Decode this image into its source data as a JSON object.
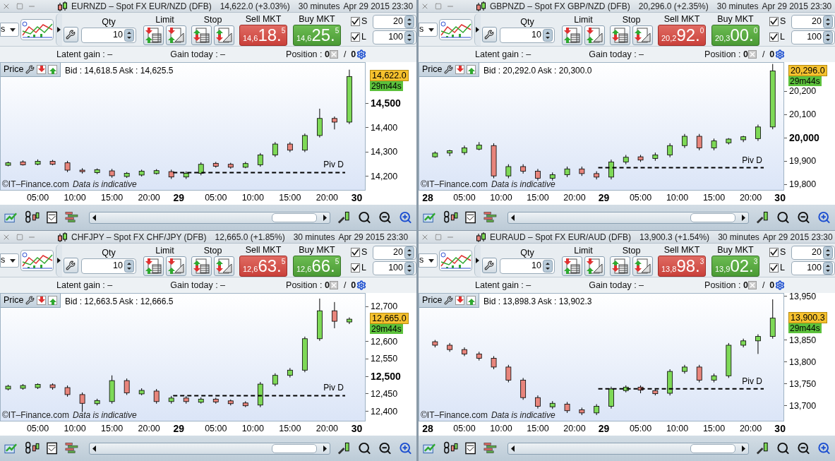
{
  "panels": [
    {
      "title": "EURNZD – Spot FX EUR/NZD (DFB)",
      "quote": "14,622.0 (+3.03%)",
      "interval": "30 minutes",
      "datetime": "Apr 29 2015 23:30",
      "dropdown": "s",
      "qty_label": "Qty",
      "qty": "10",
      "limit_label": "Limit",
      "stop_label": "Stop",
      "sell": {
        "label": "Sell MKT",
        "prefix": "14,6",
        "big": "18.",
        "sup": "5"
      },
      "buy": {
        "label": "Buy MKT",
        "prefix": "14,6",
        "big": "25.",
        "sup": "5"
      },
      "checks": [
        {
          "label": "S",
          "checked": true,
          "value": "20"
        },
        {
          "label": "L",
          "checked": true,
          "value": "100"
        }
      ],
      "latent_gain": "Latent gain : –",
      "gain_today": "Gain today : –",
      "position": "Position : **0**",
      "position_total": "/  **0**",
      "price_button": "Price",
      "bid_ask": "Bid : 14,618.5 Ask : 14,625.5",
      "last_price": "14,622.0",
      "countdown": "29m44s",
      "copyright": "©IT–Finance.com",
      "disclaimer": "Data is indicative",
      "chart_data": {
        "type": "candlestick",
        "x": [
          "2015-04-28T01:00:00Z",
          "2015-04-28T03:00:00Z",
          "2015-04-28T05:00:00Z",
          "2015-04-28T07:00:00Z",
          "2015-04-28T09:00:00Z",
          "2015-04-28T11:00:00Z",
          "2015-04-28T13:00:00Z",
          "2015-04-28T15:00:00Z",
          "2015-04-28T17:00:00Z",
          "2015-04-28T19:00:00Z",
          "2015-04-28T21:00:00Z",
          "2015-04-28T23:00:00Z",
          "2015-04-29T01:00:00Z",
          "2015-04-29T03:00:00Z",
          "2015-04-29T05:00:00Z",
          "2015-04-29T07:00:00Z",
          "2015-04-29T09:00:00Z",
          "2015-04-29T11:00:00Z",
          "2015-04-29T13:00:00Z",
          "2015-04-29T15:00:00Z",
          "2015-04-29T17:00:00Z",
          "2015-04-29T19:00:00Z",
          "2015-04-29T21:00:00Z",
          "2015-04-29T23:00:00Z"
        ],
        "ohlc": [
          [
            14248,
            14263,
            14244,
            14258
          ],
          [
            14262,
            14268,
            14247,
            14250
          ],
          [
            14252,
            14272,
            14248,
            14264
          ],
          [
            14264,
            14270,
            14248,
            14252
          ],
          [
            14258,
            14266,
            14220,
            14228
          ],
          [
            14228,
            14236,
            14214,
            14222
          ],
          [
            14218,
            14235,
            14212,
            14230
          ],
          [
            14225,
            14233,
            14197,
            14205
          ],
          [
            14202,
            14220,
            14196,
            14215
          ],
          [
            14208,
            14230,
            14202,
            14224
          ],
          [
            14214,
            14232,
            14210,
            14226
          ],
          [
            14222,
            14230,
            14192,
            14200
          ],
          [
            14200,
            14223,
            14192,
            14215
          ],
          [
            14215,
            14260,
            14207,
            14252
          ],
          [
            14256,
            14262,
            14238,
            14244
          ],
          [
            14252,
            14258,
            14234,
            14240
          ],
          [
            14240,
            14262,
            14236,
            14255
          ],
          [
            14250,
            14298,
            14242,
            14290
          ],
          [
            14290,
            14343,
            14282,
            14335
          ],
          [
            14335,
            14343,
            14302,
            14310
          ],
          [
            14310,
            14378,
            14302,
            14370
          ],
          [
            14370,
            14480,
            14362,
            14440
          ],
          [
            14440,
            14448,
            14395,
            14425
          ],
          [
            14425,
            14640,
            14417,
            14612
          ]
        ],
        "xlim": [
          "2015-04-28T00:00:00Z",
          "2015-04-30T01:06:00Z"
        ],
        "ylim": [
          14147,
          14668
        ],
        "xticks": [
          {
            "value": "2015-04-28T05:00:00Z",
            "label": "05:00"
          },
          {
            "value": "2015-04-28T10:00:00Z",
            "label": "10:00"
          },
          {
            "value": "2015-04-28T15:00:00Z",
            "label": "15:00"
          },
          {
            "value": "2015-04-28T20:00:00Z",
            "label": "20:00"
          },
          {
            "value": "2015-04-29T00:00:00Z",
            "label": "29"
          },
          {
            "value": "2015-04-29T05:00:00Z",
            "label": "05:00"
          },
          {
            "value": "2015-04-29T10:00:00Z",
            "label": "10:00"
          },
          {
            "value": "2015-04-29T15:00:00Z",
            "label": "15:00"
          },
          {
            "value": "2015-04-29T20:00:00Z",
            "label": "20:00"
          },
          {
            "value": "2015-04-30T00:00:00Z",
            "label": "30"
          }
        ],
        "yticks": [
          {
            "value": 14200,
            "label": "14,200"
          },
          {
            "value": 14300,
            "label": "14,300"
          },
          {
            "value": 14400,
            "label": "14,400"
          },
          {
            "value": 14500,
            "label": "14,500"
          }
        ],
        "ref_lines": [
          {
            "axis": "y",
            "value": 14218,
            "label": "Piv D"
          }
        ]
      }
    },
    {
      "title": "GBPNZD – Spot FX GBP/NZD (DFB)",
      "quote": "20,296.0 (+2.35%)",
      "interval": "30 minutes",
      "datetime": "Apr 29 2015 23:30",
      "dropdown": "s",
      "qty_label": "Qty",
      "qty": "10",
      "limit_label": "Limit",
      "stop_label": "Stop",
      "sell": {
        "label": "Sell MKT",
        "prefix": "20,2",
        "big": "92.",
        "sup": "0"
      },
      "buy": {
        "label": "Buy MKT",
        "prefix": "20,3",
        "big": "00.",
        "sup": "0"
      },
      "checks": [
        {
          "label": "S",
          "checked": true,
          "value": "20"
        },
        {
          "label": "L",
          "checked": true,
          "value": "100"
        }
      ],
      "latent_gain": "Latent gain : –",
      "gain_today": "Gain today : –",
      "position": "Position : **0**",
      "position_total": "/  **0**",
      "price_button": "Price",
      "bid_ask": "Bid : 20,292.0 Ask : 20,300.0",
      "last_price": "20,296.0",
      "countdown": "29m44s",
      "copyright": "©IT–Finance.com",
      "disclaimer": "Data is indicative",
      "chart_data": {
        "type": "candlestick",
        "x": [
          "2015-04-28T01:00:00Z",
          "2015-04-28T03:00:00Z",
          "2015-04-28T05:00:00Z",
          "2015-04-28T07:00:00Z",
          "2015-04-28T09:00:00Z",
          "2015-04-28T11:00:00Z",
          "2015-04-28T13:00:00Z",
          "2015-04-28T15:00:00Z",
          "2015-04-28T17:00:00Z",
          "2015-04-28T19:00:00Z",
          "2015-04-28T21:00:00Z",
          "2015-04-28T23:00:00Z",
          "2015-04-29T01:00:00Z",
          "2015-04-29T03:00:00Z",
          "2015-04-29T05:00:00Z",
          "2015-04-29T07:00:00Z",
          "2015-04-29T09:00:00Z",
          "2015-04-29T11:00:00Z",
          "2015-04-29T13:00:00Z",
          "2015-04-29T15:00:00Z",
          "2015-04-29T17:00:00Z",
          "2015-04-29T19:00:00Z",
          "2015-04-29T21:00:00Z",
          "2015-04-29T23:00:00Z"
        ],
        "ohlc": [
          [
            19922,
            19945,
            19918,
            19938
          ],
          [
            19938,
            19952,
            19925,
            19948
          ],
          [
            19940,
            19970,
            19930,
            19960
          ],
          [
            19955,
            19985,
            19950,
            19972
          ],
          [
            19970,
            19980,
            19830,
            19840
          ],
          [
            19840,
            19890,
            19830,
            19880
          ],
          [
            19880,
            19890,
            19850,
            19860
          ],
          [
            19860,
            19870,
            19820,
            19830
          ],
          [
            19830,
            19855,
            19820,
            19845
          ],
          [
            19845,
            19880,
            19835,
            19870
          ],
          [
            19870,
            19880,
            19840,
            19850
          ],
          [
            19850,
            19860,
            19825,
            19835
          ],
          [
            19835,
            19910,
            19825,
            19900
          ],
          [
            19900,
            19930,
            19890,
            19920
          ],
          [
            19922,
            19930,
            19900,
            19908
          ],
          [
            19915,
            19940,
            19905,
            19930
          ],
          [
            19930,
            19980,
            19920,
            19970
          ],
          [
            19970,
            20020,
            19960,
            20010
          ],
          [
            20010,
            20020,
            19950,
            19960
          ],
          [
            19960,
            20000,
            19950,
            19990
          ],
          [
            19982,
            20002,
            19975,
            19998
          ],
          [
            19995,
            20012,
            19985,
            20008
          ],
          [
            20000,
            20060,
            19990,
            20050
          ],
          [
            20050,
            20320,
            20040,
            20290
          ]
        ],
        "xlim": [
          "2015-04-27T22:51:00Z",
          "2015-04-30T00:28:00Z"
        ],
        "ylim": [
          19780,
          20325
        ],
        "xticks": [
          {
            "value": "2015-04-28T00:00:00Z",
            "label": "28"
          },
          {
            "value": "2015-04-28T05:00:00Z",
            "label": "05:00"
          },
          {
            "value": "2015-04-28T10:00:00Z",
            "label": "10:00"
          },
          {
            "value": "2015-04-28T15:00:00Z",
            "label": "15:00"
          },
          {
            "value": "2015-04-28T20:00:00Z",
            "label": "20:00"
          },
          {
            "value": "2015-04-29T00:00:00Z",
            "label": "29"
          },
          {
            "value": "2015-04-29T05:00:00Z",
            "label": "05:00"
          },
          {
            "value": "2015-04-29T10:00:00Z",
            "label": "10:00"
          },
          {
            "value": "2015-04-29T15:00:00Z",
            "label": "15:00"
          },
          {
            "value": "2015-04-29T20:00:00Z",
            "label": "20:00"
          },
          {
            "value": "2015-04-30T00:00:00Z",
            "label": "30"
          }
        ],
        "yticks": [
          {
            "value": 19800,
            "label": "19,800"
          },
          {
            "value": 19900,
            "label": "19,900"
          },
          {
            "value": 20000,
            "label": "20,000"
          },
          {
            "value": 20100,
            "label": "20,100"
          },
          {
            "value": 20200,
            "label": "20,200"
          }
        ],
        "ref_lines": [
          {
            "axis": "y",
            "value": 19875,
            "label": "Piv D"
          }
        ]
      }
    },
    {
      "title": "CHFJPY – Spot FX CHF/JPY (DFB)",
      "quote": "12,665.0 (+1.85%)",
      "interval": "30 minutes",
      "datetime": "Apr 29 2015 23:30",
      "dropdown": "s",
      "qty_label": "Qty",
      "qty": "10",
      "limit_label": "Limit",
      "stop_label": "Stop",
      "sell": {
        "label": "Sell MKT",
        "prefix": "12,6",
        "big": "63.",
        "sup": "5"
      },
      "buy": {
        "label": "Buy MKT",
        "prefix": "12,6",
        "big": "66.",
        "sup": "5"
      },
      "checks": [
        {
          "label": "S",
          "checked": true,
          "value": "20"
        },
        {
          "label": "L",
          "checked": true,
          "value": "100"
        }
      ],
      "latent_gain": "Latent gain : –",
      "gain_today": "Gain today : –",
      "position": "Position : **0**",
      "position_total": "/  **0**",
      "price_button": "Price",
      "bid_ask": "Bid : 12,663.5 Ask : 12,666.5",
      "last_price": "12,665.0",
      "countdown": "29m44s",
      "copyright": "©IT–Finance.com",
      "disclaimer": "Data is indicative",
      "chart_data": {
        "type": "candlestick",
        "x": [
          "2015-04-28T01:00:00Z",
          "2015-04-28T03:00:00Z",
          "2015-04-28T05:00:00Z",
          "2015-04-28T07:00:00Z",
          "2015-04-28T09:00:00Z",
          "2015-04-28T11:00:00Z",
          "2015-04-28T13:00:00Z",
          "2015-04-28T15:00:00Z",
          "2015-04-28T17:00:00Z",
          "2015-04-28T19:00:00Z",
          "2015-04-28T21:00:00Z",
          "2015-04-28T23:00:00Z",
          "2015-04-29T01:00:00Z",
          "2015-04-29T03:00:00Z",
          "2015-04-29T05:00:00Z",
          "2015-04-29T07:00:00Z",
          "2015-04-29T09:00:00Z",
          "2015-04-29T11:00:00Z",
          "2015-04-29T13:00:00Z",
          "2015-04-29T15:00:00Z",
          "2015-04-29T17:00:00Z",
          "2015-04-29T19:00:00Z",
          "2015-04-29T21:00:00Z",
          "2015-04-29T23:00:00Z"
        ],
        "ohlc": [
          [
            12466,
            12478,
            12462,
            12474
          ],
          [
            12468,
            12480,
            12464,
            12476
          ],
          [
            12470,
            12482,
            12466,
            12479
          ],
          [
            12478,
            12482,
            12464,
            12470
          ],
          [
            12470,
            12476,
            12444,
            12450
          ],
          [
            12450,
            12456,
            12400,
            12425
          ],
          [
            12424,
            12438,
            12419,
            12433
          ],
          [
            12430,
            12505,
            12424,
            12490
          ],
          [
            12490,
            12496,
            12449,
            12455
          ],
          [
            12452,
            12468,
            12448,
            12462
          ],
          [
            12460,
            12466,
            12424,
            12430
          ],
          [
            12430,
            12446,
            12424,
            12440
          ],
          [
            12440,
            12446,
            12424,
            12430
          ],
          [
            12428,
            12442,
            12424,
            12437
          ],
          [
            12437,
            12441,
            12424,
            12429
          ],
          [
            12432,
            12436,
            12419,
            12424
          ],
          [
            12426,
            12431,
            12414,
            12418
          ],
          [
            12420,
            12486,
            12414,
            12480
          ],
          [
            12480,
            12511,
            12474,
            12505
          ],
          [
            12505,
            12526,
            12499,
            12520
          ],
          [
            12520,
            12616,
            12514,
            12610
          ],
          [
            12610,
            12725,
            12604,
            12690
          ],
          [
            12690,
            12715,
            12640,
            12660
          ],
          [
            12658,
            12671,
            12652,
            12666
          ]
        ],
        "xlim": [
          "2015-04-28T00:00:00Z",
          "2015-04-30T01:06:00Z"
        ],
        "ylim": [
          12375,
          12739
        ],
        "xticks": [
          {
            "value": "2015-04-28T05:00:00Z",
            "label": "05:00"
          },
          {
            "value": "2015-04-28T10:00:00Z",
            "label": "10:00"
          },
          {
            "value": "2015-04-28T15:00:00Z",
            "label": "15:00"
          },
          {
            "value": "2015-04-28T20:00:00Z",
            "label": "20:00"
          },
          {
            "value": "2015-04-29T00:00:00Z",
            "label": "29"
          },
          {
            "value": "2015-04-29T05:00:00Z",
            "label": "05:00"
          },
          {
            "value": "2015-04-29T10:00:00Z",
            "label": "10:00"
          },
          {
            "value": "2015-04-29T15:00:00Z",
            "label": "15:00"
          },
          {
            "value": "2015-04-29T20:00:00Z",
            "label": "20:00"
          },
          {
            "value": "2015-04-30T00:00:00Z",
            "label": "30"
          }
        ],
        "yticks": [
          {
            "value": 12400,
            "label": "12,400"
          },
          {
            "value": 12450,
            "label": "12,450"
          },
          {
            "value": 12500,
            "label": "12,500"
          },
          {
            "value": 12550,
            "label": "12,550"
          },
          {
            "value": 12600,
            "label": "12,600"
          },
          {
            "value": 12700,
            "label": "12,700"
          }
        ],
        "ref_lines": [
          {
            "axis": "y",
            "value": 12447,
            "label": "Piv D"
          }
        ]
      }
    },
    {
      "title": "EURAUD – Spot FX EUR/AUD (DFB)",
      "quote": "13,900.3 (+1.54%)",
      "interval": "30 minutes",
      "datetime": "Apr 29 2015 23:30",
      "dropdown": "s",
      "qty_label": "Qty",
      "qty": "10",
      "limit_label": "Limit",
      "stop_label": "Stop",
      "sell": {
        "label": "Sell MKT",
        "prefix": "13,8",
        "big": "98.",
        "sup": "3"
      },
      "buy": {
        "label": "Buy MKT",
        "prefix": "13,9",
        "big": "02.",
        "sup": "3"
      },
      "checks": [
        {
          "label": "S",
          "checked": true,
          "value": "20"
        },
        {
          "label": "L",
          "checked": true,
          "value": "100"
        }
      ],
      "latent_gain": "Latent gain : –",
      "gain_today": "Gain today : –",
      "position": "Position : **0**",
      "position_total": "/  **0**",
      "price_button": "Price",
      "bid_ask": "Bid : 13,898.3 Ask : 13,902.3",
      "last_price": "13,900.3",
      "countdown": "29m44s",
      "copyright": "©IT–Finance.com",
      "disclaimer": "Data is indicative",
      "chart_data": {
        "type": "candlestick",
        "x": [
          "2015-04-28T01:00:00Z",
          "2015-04-28T03:00:00Z",
          "2015-04-28T05:00:00Z",
          "2015-04-28T07:00:00Z",
          "2015-04-28T09:00:00Z",
          "2015-04-28T11:00:00Z",
          "2015-04-28T13:00:00Z",
          "2015-04-28T15:00:00Z",
          "2015-04-28T17:00:00Z",
          "2015-04-28T19:00:00Z",
          "2015-04-28T21:00:00Z",
          "2015-04-28T23:00:00Z",
          "2015-04-29T01:00:00Z",
          "2015-04-29T03:00:00Z",
          "2015-04-29T05:00:00Z",
          "2015-04-29T07:00:00Z",
          "2015-04-29T09:00:00Z",
          "2015-04-29T11:00:00Z",
          "2015-04-29T13:00:00Z",
          "2015-04-29T15:00:00Z",
          "2015-04-29T17:00:00Z",
          "2015-04-29T19:00:00Z",
          "2015-04-29T21:00:00Z",
          "2015-04-29T23:00:00Z"
        ],
        "ohlc": [
          [
            13848,
            13852,
            13835,
            13840
          ],
          [
            13840,
            13845,
            13825,
            13830
          ],
          [
            13830,
            13835,
            13815,
            13820
          ],
          [
            13820,
            13825,
            13805,
            13810
          ],
          [
            13810,
            13815,
            13785,
            13790
          ],
          [
            13790,
            13795,
            13755,
            13760
          ],
          [
            13760,
            13765,
            13715,
            13720
          ],
          [
            13720,
            13725,
            13695,
            13700
          ],
          [
            13699,
            13712,
            13694,
            13707
          ],
          [
            13705,
            13710,
            13685,
            13690
          ],
          [
            13692,
            13697,
            13680,
            13685
          ],
          [
            13685,
            13705,
            13680,
            13700
          ],
          [
            13700,
            13745,
            13695,
            13740
          ],
          [
            13736,
            13748,
            13732,
            13744
          ],
          [
            13744,
            13748,
            13730,
            13737
          ],
          [
            13736,
            13740,
            13725,
            13729
          ],
          [
            13730,
            13785,
            13725,
            13780
          ],
          [
            13780,
            13795,
            13775,
            13790
          ],
          [
            13790,
            13795,
            13755,
            13760
          ],
          [
            13760,
            13775,
            13755,
            13770
          ],
          [
            13770,
            13845,
            13765,
            13840
          ],
          [
            13840,
            13855,
            13835,
            13850
          ],
          [
            13850,
            13865,
            13820,
            13860
          ],
          [
            13860,
            13945,
            13855,
            13902
          ]
        ],
        "xlim": [
          "2015-04-27T22:51:00Z",
          "2015-04-30T00:28:00Z"
        ],
        "ylim": [
          13667,
          13958
        ],
        "xticks": [
          {
            "value": "2015-04-28T00:00:00Z",
            "label": "28"
          },
          {
            "value": "2015-04-28T05:00:00Z",
            "label": "05:00"
          },
          {
            "value": "2015-04-28T10:00:00Z",
            "label": "10:00"
          },
          {
            "value": "2015-04-28T15:00:00Z",
            "label": "15:00"
          },
          {
            "value": "2015-04-28T20:00:00Z",
            "label": "20:00"
          },
          {
            "value": "2015-04-29T00:00:00Z",
            "label": "29"
          },
          {
            "value": "2015-04-29T05:00:00Z",
            "label": "05:00"
          },
          {
            "value": "2015-04-29T10:00:00Z",
            "label": "10:00"
          },
          {
            "value": "2015-04-29T15:00:00Z",
            "label": "15:00"
          },
          {
            "value": "2015-04-29T20:00:00Z",
            "label": "20:00"
          },
          {
            "value": "2015-04-30T00:00:00Z",
            "label": "30"
          }
        ],
        "yticks": [
          {
            "value": 13700,
            "label": "13,700"
          },
          {
            "value": 13750,
            "label": "13,750"
          },
          {
            "value": 13800,
            "label": "13,800"
          },
          {
            "value": 13850,
            "label": "13,850"
          },
          {
            "value": 13950,
            "label": "13,950"
          }
        ],
        "ref_lines": [
          {
            "axis": "y",
            "value": 13740,
            "label": "Piv D"
          }
        ]
      }
    }
  ]
}
